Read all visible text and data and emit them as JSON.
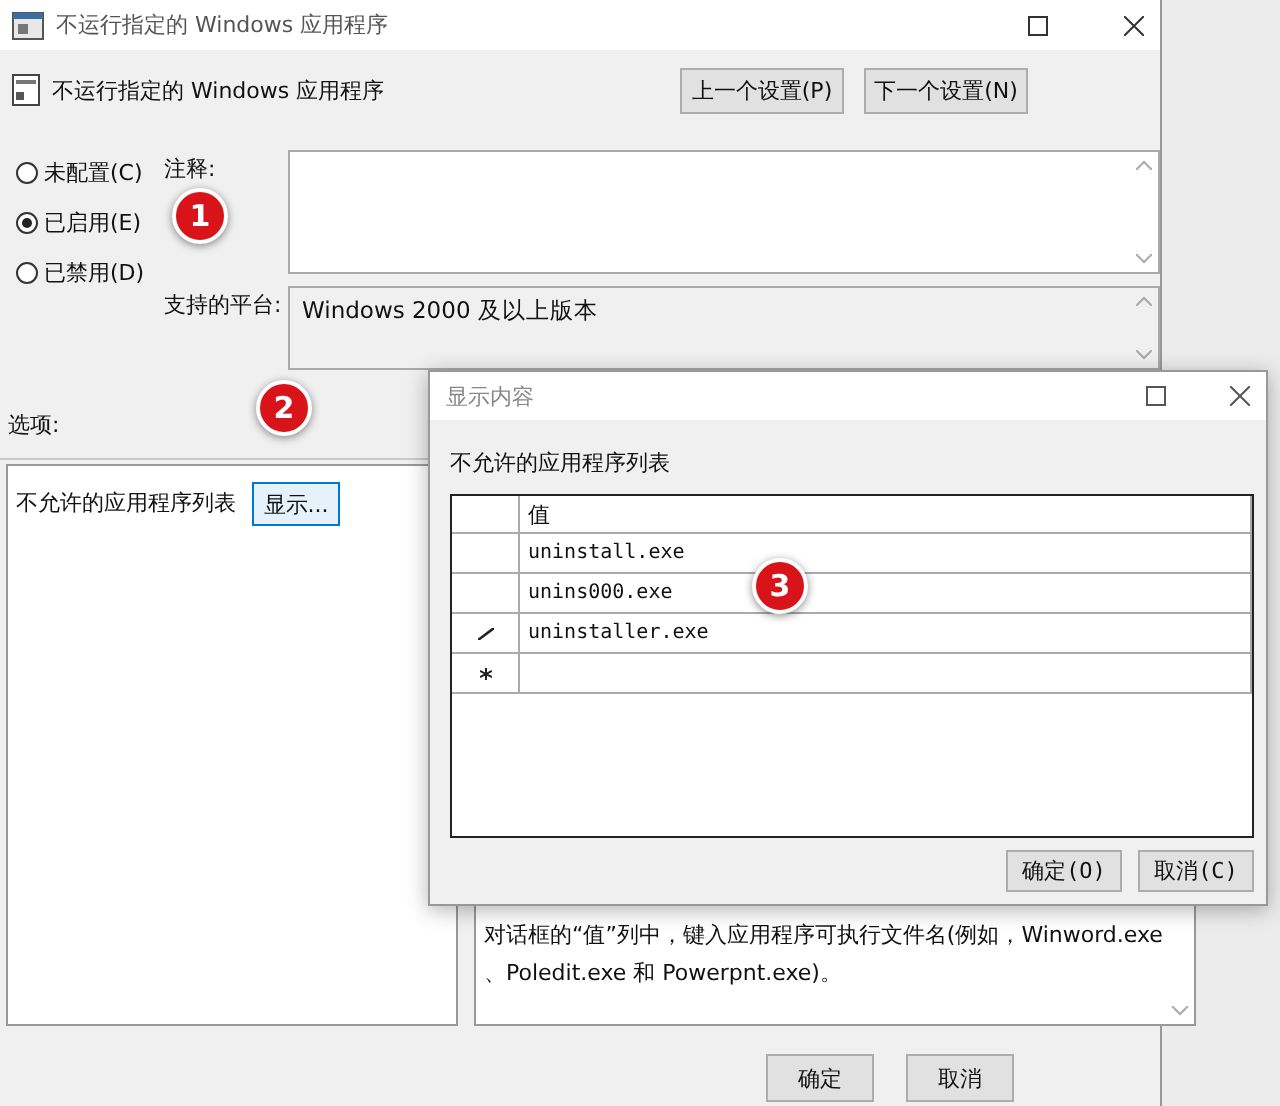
{
  "window": {
    "title": "不运行指定的 Windows 应用程序"
  },
  "header": {
    "title": "不运行指定的 Windows 应用程序",
    "buttons": [
      "上一个设置(P)",
      "下一个设置(N)"
    ]
  },
  "states": [
    {
      "label": "未配置(C)",
      "selected": false
    },
    {
      "label": "已启用(E)",
      "selected": true
    },
    {
      "label": "已禁用(D)",
      "selected": false
    }
  ],
  "comment": {
    "label": "注释:"
  },
  "platform": {
    "label": "支持的平台:",
    "value": "Windows 2000 及以上版本"
  },
  "options": {
    "label": "选项:",
    "list_label": "不允许的应用程序列表",
    "show_button": "显示..."
  },
  "help": {
    "lines": [
      "对话框的“值”列中，键入应用程序可执行文件名(例如，Winword.exe",
      "、Poledit.exe 和 Powerpnt.exe)。"
    ]
  },
  "buttons": [
    "确定",
    "取消"
  ],
  "markers": [
    "1",
    "2",
    "3"
  ],
  "dialog": {
    "title": "显示内容",
    "label": "不允许的应用程序列表",
    "column": "值",
    "rows": [
      {
        "kind": "row",
        "value": "uninstall.exe"
      },
      {
        "kind": "row",
        "value": "unins000.exe"
      },
      {
        "kind": "editing",
        "value": "uninstaller.exe"
      },
      {
        "kind": "new"
      }
    ],
    "buttons": [
      "确定(O)",
      "取消(C)"
    ]
  }
}
